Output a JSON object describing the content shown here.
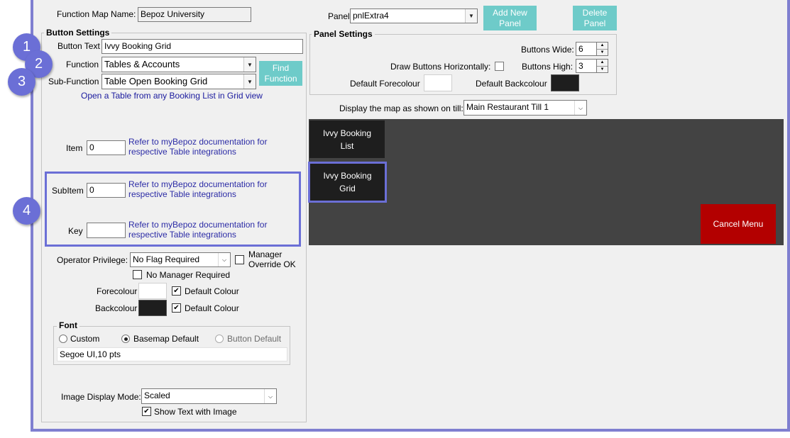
{
  "header": {
    "function_map_label": "Function Map Name:",
    "function_map_value": "Bepoz University",
    "panel_label": "Panel",
    "panel_value": "pnlExtra4",
    "add_new_panel_label": "Add New Panel",
    "delete_panel_label": "Delete Panel"
  },
  "button_settings": {
    "title": "Button Settings",
    "button_text_label": "Button Text",
    "button_text_value": "Ivvy Booking Grid",
    "function_label": "Function",
    "function_value": "Tables & Accounts",
    "sub_function_label": "Sub-Function",
    "sub_function_value": "Table Open Booking Grid",
    "find_function_label": "Find Function",
    "description": "Open a Table from any Booking List in Grid view",
    "item_label": "Item",
    "item_value": "0",
    "item_note": "Refer to myBepoz documentation for respective Table integrations",
    "subitem_label": "SubItem",
    "subitem_value": "0",
    "subitem_note": "Refer to myBepoz documentation for respective Table integrations",
    "key_label": "Key",
    "key_value": "",
    "key_note": "Refer to myBepoz documentation for respective Table integrations",
    "operator_privilege_label": "Operator Privilege:",
    "operator_privilege_value": "No Flag Required",
    "manager_override_label": "Manager Override OK",
    "manager_override_checked": false,
    "no_manager_required_label": "No Manager Required",
    "no_manager_required_checked": false,
    "forecolour_label": "Forecolour",
    "forecolour_color": "#ffffff",
    "forecolour_default_label": "Default Colour",
    "forecolour_default_checked": true,
    "backcolour_label": "Backcolour",
    "backcolour_color": "#1e1e1e",
    "backcolour_default_label": "Default Colour",
    "backcolour_default_checked": true,
    "font": {
      "title": "Font",
      "options": [
        "Custom",
        "Basemap Default",
        "Button Default"
      ],
      "selected": "Basemap Default",
      "value": "Segoe UI,10 pts"
    },
    "image_display_mode_label": "Image Display Mode:",
    "image_display_mode_value": "Scaled",
    "show_text_with_image_label": "Show Text with Image",
    "show_text_with_image_checked": true
  },
  "panel_settings": {
    "title": "Panel Settings",
    "buttons_wide_label": "Buttons Wide:",
    "buttons_wide_value": "6",
    "draw_horizontally_label": "Draw Buttons Horizontally:",
    "draw_horizontally_checked": false,
    "buttons_high_label": "Buttons High:",
    "buttons_high_value": "3",
    "default_forecolour_label": "Default Forecolour",
    "default_forecolour_color": "#ffffff",
    "default_backcolour_label": "Default Backcolour",
    "default_backcolour_color": "#1e1e1e"
  },
  "till": {
    "label": "Display the map as shown on till:",
    "value": "Main Restaurant Till 1"
  },
  "preview": {
    "background": "#434343",
    "tiles": [
      {
        "label": "Ivvy Booking List"
      },
      {
        "label": "Ivvy Booking Grid"
      },
      {
        "label": "Cancel Menu"
      }
    ]
  },
  "callouts": [
    "1",
    "2",
    "3",
    "4"
  ],
  "colors": {
    "accent": "#6b6fd6",
    "frame": "#7f7fd0",
    "teal_button": "#6ecbc9",
    "cancel_red": "#b30000"
  }
}
